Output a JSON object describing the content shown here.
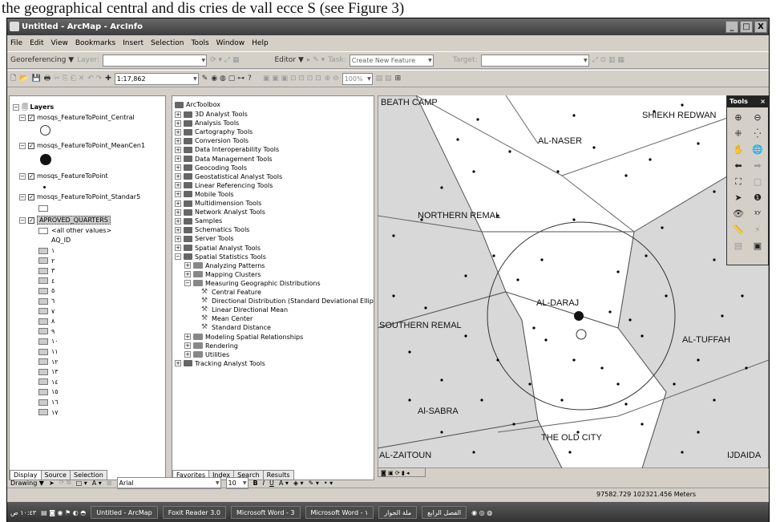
{
  "caption": "the geographical central and dis cries de vall ecce S (see Figure 3)",
  "window": {
    "title": "Untitled - ArcMap - ArcInfo",
    "controls": [
      "_",
      "□",
      "X"
    ]
  },
  "menu": [
    "File",
    "Edit",
    "View",
    "Bookmarks",
    "Insert",
    "Selection",
    "Tools",
    "Window",
    "Help"
  ],
  "toolbar1": {
    "georef": "Georeferencing ▼",
    "layer_label": "Layer:",
    "editor": "Editor ▼",
    "task_label": "Task:",
    "task_value": "Create New Feature",
    "target_label": "Target:"
  },
  "toolbar2": {
    "scale": "1:17,862",
    "zoom": "100%"
  },
  "toc": {
    "root": "Layers",
    "layers": [
      {
        "name": "mosqs_FeatureToPoint_Central"
      },
      {
        "name": "mosqs_FeatureToPoint_MeanCen1"
      },
      {
        "name": "mosqs_FeatureToPoint"
      },
      {
        "name": "mosqs_FeatureToPoint_Standar5"
      },
      {
        "name": "APROVED_QUARTERS"
      }
    ],
    "other_values": "<all other values>",
    "field": "AQ_ID",
    "classes": [
      "١",
      "٢",
      "٣",
      "٤",
      "٥",
      "٦",
      "٧",
      "٨",
      "٩",
      "١٠",
      "١١",
      "١٢",
      "١٣",
      "١٤",
      "١٥",
      "١٦",
      "١٧"
    ],
    "tabs": [
      "Display",
      "Source",
      "Selection"
    ]
  },
  "toolbox": {
    "root": "ArcToolbox",
    "items": [
      "3D Analyst Tools",
      "Analysis Tools",
      "Cartography Tools",
      "Conversion Tools",
      "Data Interoperability Tools",
      "Data Management Tools",
      "Geocoding Tools",
      "Geostatistical Analyst Tools",
      "Linear Referencing Tools",
      "Mobile Tools",
      "Multidimension Tools",
      "Network Analyst Tools",
      "Samples",
      "Schematics Tools",
      "Server Tools",
      "Spatial Analyst Tools",
      "Spatial Statistics Tools"
    ],
    "spatial_sub": [
      "Analyzing Patterns",
      "Mapping Clusters",
      "Measuring Geographic Distributions"
    ],
    "measuring_tools": [
      "Central Feature",
      "Directional Distribution (Standard Deviational Ellipse)",
      "Linear Directional Mean",
      "Mean Center",
      "Standard Distance"
    ],
    "spatial_sub2": [
      "Modeling Spatial Relationships",
      "Rendering",
      "Utilities"
    ],
    "last": "Tracking Analyst Tools",
    "tabs": [
      "Favorites",
      "Index",
      "Search",
      "Results"
    ]
  },
  "map": {
    "labels": [
      "BEATH CAMP",
      "SHIEKH REDWAN",
      "AL-NASER",
      "NORTHERN REMAL",
      "AL-DARAJ",
      "SOUTHERN REMAL",
      "AL-TUFFAH",
      "Al-SABRA",
      "THE OLD CITY",
      "AL-ZAITOUN",
      "IJDAIDA"
    ]
  },
  "tools_window": {
    "title": "Tools",
    "close": "×"
  },
  "drawing": {
    "label": "Drawing ▼",
    "font": "Arial",
    "size": "10",
    "bold": "B",
    "italic": "I",
    "underline": "U"
  },
  "status": {
    "coords": "97582.729  102321.456 Meters"
  },
  "taskbar": {
    "clock": "١٠:٤٣ ص",
    "tasks": [
      "Untitled - ArcMap",
      "Foxit Reader 3.0",
      "Microsoft Word - 3",
      "Microsoft Word - ١",
      "ملة الجوار",
      "الفصل الرابع"
    ]
  }
}
